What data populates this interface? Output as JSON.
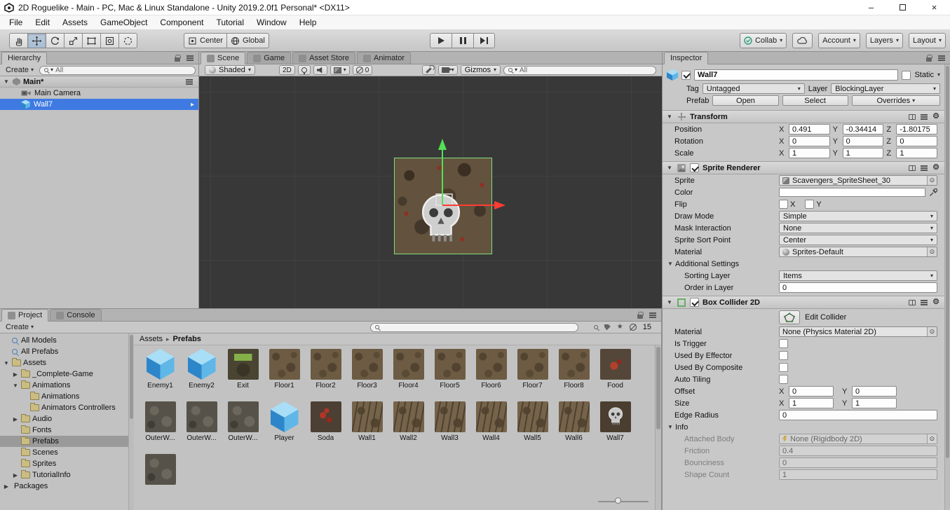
{
  "window": {
    "title": "2D Roguelike - Main - PC, Mac & Linux Standalone - Unity 2019.2.0f1 Personal* <DX11>",
    "menu_items": [
      "File",
      "Edit",
      "Assets",
      "GameObject",
      "Component",
      "Tutorial",
      "Window",
      "Help"
    ]
  },
  "toolbar": {
    "pivot_label": "Center",
    "space_label": "Global",
    "collab_label": "Collab",
    "account_label": "Account",
    "layers_label": "Layers",
    "layout_label": "Layout"
  },
  "hierarchy": {
    "tab_title": "Hierarchy",
    "create_label": "Create",
    "search_value": "All",
    "scene_name": "Main*",
    "items": [
      {
        "label": "Main Camera",
        "icon": "camera",
        "selected": false
      },
      {
        "label": "Wall7",
        "icon": "cube",
        "selected": true
      }
    ]
  },
  "center": {
    "tabs": [
      "Scene",
      "Game",
      "Asset Store",
      "Animator"
    ],
    "active_tab": "Scene",
    "shading_mode": "Shaded",
    "mode_2d": "2D",
    "hidden_count": "0",
    "gizmos_label": "Gizmos",
    "search_value": "All"
  },
  "project": {
    "tabs": [
      "Project",
      "Console"
    ],
    "active_tab": "Project",
    "create_label": "Create",
    "search_value": "",
    "result_count": "15",
    "breadcrumb": [
      "Assets",
      "Prefabs"
    ],
    "tree": [
      {
        "label": "All Models",
        "depth": 0,
        "icon": "search",
        "arrow": "none",
        "selected": false
      },
      {
        "label": "All Prefabs",
        "depth": 0,
        "icon": "search",
        "arrow": "none",
        "selected": false
      },
      {
        "label": "Assets",
        "depth": 0,
        "icon": "folder",
        "arrow": "open",
        "selected": false
      },
      {
        "label": "_Complete-Game",
        "depth": 1,
        "icon": "folder",
        "arrow": "closed",
        "selected": false
      },
      {
        "label": "Animations",
        "depth": 1,
        "icon": "folder",
        "arrow": "open",
        "selected": false
      },
      {
        "label": "Animations",
        "depth": 2,
        "icon": "folder",
        "arrow": "none",
        "selected": false
      },
      {
        "label": "Animators Controllers",
        "depth": 2,
        "icon": "folder",
        "arrow": "none",
        "selected": false
      },
      {
        "label": "Audio",
        "depth": 1,
        "icon": "folder",
        "arrow": "closed",
        "selected": false
      },
      {
        "label": "Fonts",
        "depth": 1,
        "icon": "folder",
        "arrow": "none",
        "selected": false
      },
      {
        "label": "Prefabs",
        "depth": 1,
        "icon": "folder",
        "arrow": "none",
        "selected": true
      },
      {
        "label": "Scenes",
        "depth": 1,
        "icon": "folder",
        "arrow": "none",
        "selected": false
      },
      {
        "label": "Sprites",
        "depth": 1,
        "icon": "folder",
        "arrow": "none",
        "selected": false
      },
      {
        "label": "TutorialInfo",
        "depth": 1,
        "icon": "folder",
        "arrow": "closed",
        "selected": false
      },
      {
        "label": "Packages",
        "depth": 0,
        "icon": "package",
        "arrow": "closed",
        "selected": false
      }
    ],
    "assets": [
      {
        "name": "Enemy1",
        "icon": "cube"
      },
      {
        "name": "Enemy2",
        "icon": "cube"
      },
      {
        "name": "Exit",
        "icon": "exit"
      },
      {
        "name": "Floor1",
        "icon": "floor"
      },
      {
        "name": "Floor2",
        "icon": "floor"
      },
      {
        "name": "Floor3",
        "icon": "floor"
      },
      {
        "name": "Floor4",
        "icon": "floor"
      },
      {
        "name": "Floor5",
        "icon": "floor"
      },
      {
        "name": "Floor6",
        "icon": "floor"
      },
      {
        "name": "Floor7",
        "icon": "floor"
      },
      {
        "name": "Floor8",
        "icon": "floor"
      },
      {
        "name": "Food",
        "icon": "food"
      },
      {
        "name": "OuterW...",
        "icon": "outer"
      },
      {
        "name": "OuterW...",
        "icon": "outer"
      },
      {
        "name": "OuterW...",
        "icon": "outer"
      },
      {
        "name": "Player",
        "icon": "cube"
      },
      {
        "name": "Soda",
        "icon": "soda"
      },
      {
        "name": "Wall1",
        "icon": "wall"
      },
      {
        "name": "Wall2",
        "icon": "wall"
      },
      {
        "name": "Wall3",
        "icon": "wall"
      },
      {
        "name": "Wall4",
        "icon": "wall"
      },
      {
        "name": "Wall5",
        "icon": "wall"
      },
      {
        "name": "Wall6",
        "icon": "wall"
      },
      {
        "name": "Wall7",
        "icon": "skull"
      },
      {
        "name": "",
        "icon": "outer"
      }
    ]
  },
  "inspector": {
    "tab_title": "Inspector",
    "axis": [
      "X",
      "Y",
      "Z"
    ],
    "header": {
      "name": "Wall7",
      "static_label": "Static",
      "tag_label": "Tag",
      "tag_value": "Untagged",
      "layer_label": "Layer",
      "layer_value": "BlockingLayer",
      "prefab_label": "Prefab",
      "open_label": "Open",
      "select_label": "Select",
      "overrides_label": "Overrides"
    },
    "transform": {
      "title": "Transform",
      "rows": [
        {
          "label": "Position",
          "values": [
            "0.491",
            "-0.34414",
            "-1.80175"
          ]
        },
        {
          "label": "Rotation",
          "values": [
            "0",
            "0",
            "0"
          ]
        },
        {
          "label": "Scale",
          "values": [
            "1",
            "1",
            "1"
          ]
        }
      ]
    },
    "sprite_renderer": {
      "title": "Sprite Renderer",
      "sprite_label": "Sprite",
      "sprite_value": "Scavengers_SpriteSheet_30",
      "color_label": "Color",
      "flip_label": "Flip",
      "flip_x": "X",
      "flip_y": "Y",
      "draw_mode_label": "Draw Mode",
      "draw_mode_value": "Simple",
      "mask_label": "Mask Interaction",
      "mask_value": "None",
      "sort_point_label": "Sprite Sort Point",
      "sort_point_value": "Center",
      "material_label": "Material",
      "material_value": "Sprites-Default",
      "additional_label": "Additional Settings",
      "sorting_layer_label": "Sorting Layer",
      "sorting_layer_value": "Items",
      "order_label": "Order in Layer",
      "order_value": "0"
    },
    "box_collider": {
      "title": "Box Collider 2D",
      "edit_label": "Edit Collider",
      "material_label": "Material",
      "material_value": "None (Physics Material 2D)",
      "trigger_label": "Is Trigger",
      "effector_label": "Used By Effector",
      "composite_label": "Used By Composite",
      "tiling_label": "Auto Tiling",
      "offset_label": "Offset",
      "offset_x": "0",
      "offset_y": "0",
      "size_label": "Size",
      "size_x": "1",
      "size_y": "1",
      "edge_label": "Edge Radius",
      "edge_value": "0",
      "info_label": "Info",
      "attached_label": "Attached Body",
      "attached_value": "None (Rigidbody 2D)",
      "friction_label": "Friction",
      "friction_value": "0.4",
      "bounciness_label": "Bounciness",
      "bounciness_value": "0",
      "shape_label": "Shape Count",
      "shape_value": "1"
    }
  }
}
